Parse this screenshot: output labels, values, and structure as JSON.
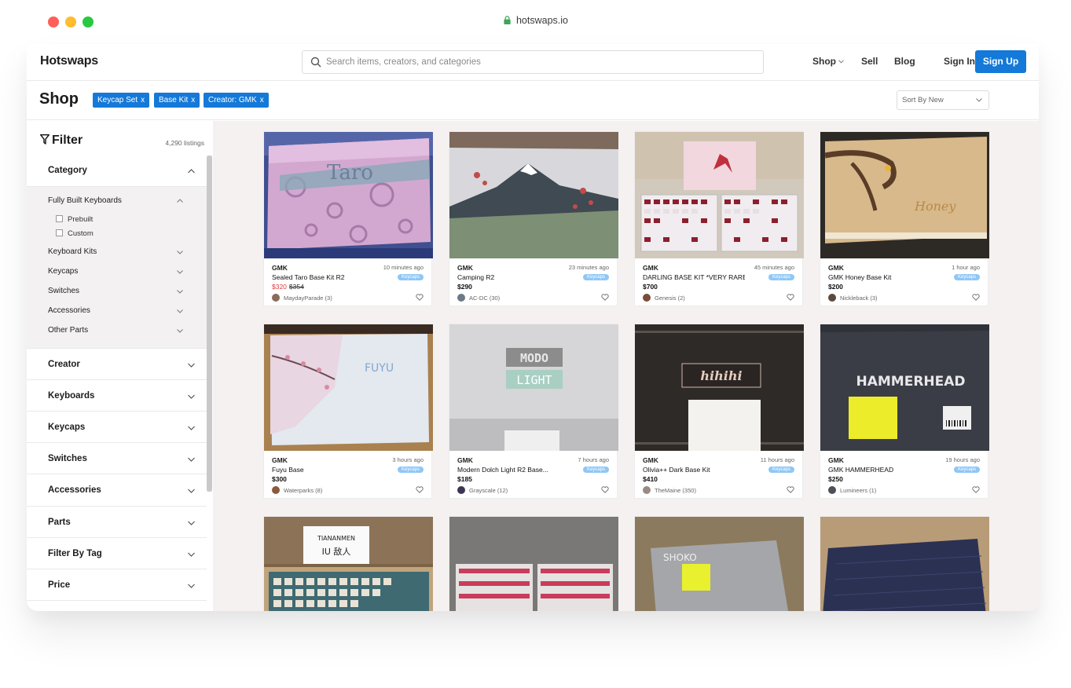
{
  "browser": {
    "url": "hotswaps.io"
  },
  "header": {
    "logo": "Hotswaps",
    "search_placeholder": "Search items, creators, and categories",
    "nav": {
      "shop": "Shop",
      "sell": "Sell",
      "blog": "Blog",
      "sign_in": "Sign In",
      "sign_up": "Sign Up"
    }
  },
  "shopbar": {
    "title": "Shop",
    "chips": [
      "Keycap Set",
      "Base Kit",
      "Creator: GMK"
    ],
    "chip_close": "x",
    "sort": "Sort By New"
  },
  "sidebar": {
    "title": "Filter",
    "listings": "4,290 listings",
    "category": {
      "title": "Category",
      "items": [
        "Fully Built Keyboards",
        "Keyboard Kits",
        "Keycaps",
        "Switches",
        "Accessories",
        "Other Parts"
      ],
      "checkboxes": [
        "Prebuilt",
        "Custom"
      ]
    },
    "sections": [
      "Creator",
      "Keyboards",
      "Keycaps",
      "Switches",
      "Accessories",
      "Parts",
      "Filter By Tag",
      "Price"
    ]
  },
  "listings": [
    {
      "brand": "GMK",
      "time": "10 minutes ago",
      "name": "Sealed Taro Base Kit R2",
      "tag": "Keycaps",
      "price": "$320",
      "old_price": "$354",
      "seller": "MaydayParade (3)",
      "image_icon": "taro-box-image"
    },
    {
      "brand": "GMK",
      "time": "23 minutes ago",
      "name": "Camping R2",
      "tag": "Keycaps",
      "price": "$290",
      "seller": "AC-DC (30)",
      "image_icon": "mountain-box-image"
    },
    {
      "brand": "GMK",
      "time": "45 minutes ago",
      "name": "DARLING BASE KIT *VERY RARE*",
      "tag": "Keycaps",
      "price": "$700",
      "seller": "Genesis (2)",
      "image_icon": "darling-keycaps-image"
    },
    {
      "brand": "GMK",
      "time": "1 hour ago",
      "name": "GMK Honey Base Kit",
      "tag": "Keycaps",
      "price": "$200",
      "seller": "Nickleback (3)",
      "image_icon": "honey-box-image"
    },
    {
      "brand": "GMK",
      "time": "3 hours ago",
      "name": "Fuyu Base",
      "tag": "Keycaps",
      "price": "$300",
      "seller": "Waterparks (8)",
      "image_icon": "fuyu-box-image"
    },
    {
      "brand": "GMK",
      "time": "7 hours ago",
      "name": "Modern Dolch Light R2 Base...",
      "tag": "Keycaps",
      "price": "$185",
      "seller": "Grayscale (12)",
      "image_icon": "modo-light-box-image"
    },
    {
      "brand": "GMK",
      "time": "11 hours ago",
      "name": "Olivia++ Dark Base Kit",
      "tag": "Keycaps",
      "price": "$410",
      "seller": "TheMaine (350)",
      "image_icon": "olivia-box-image"
    },
    {
      "brand": "GMK",
      "time": "19 hours ago",
      "name": "GMK HAMMERHEAD",
      "tag": "Keycaps",
      "price": "$250",
      "seller": "Lumineers (1)",
      "image_icon": "hammerhead-box-image"
    },
    {
      "image_icon": "tiananmen-keycaps-image",
      "image_text": [
        "TIANANMEN",
        "IU 敌人"
      ]
    },
    {
      "image_icon": "red-keycaps-image"
    },
    {
      "image_icon": "shoko-box-image",
      "image_text": [
        "SHOKO"
      ]
    },
    {
      "image_icon": "navy-keycaps-image"
    }
  ],
  "image_text": {
    "taro": "Taro",
    "fuyu": "FUYU",
    "modo": "MODO",
    "light": "LIGHT",
    "hihihi": "hihihi",
    "hammerhead": "HAMMERHEAD",
    "honey": "Honey"
  },
  "colors": {
    "accent": "#1479d8",
    "tag": "#8ec7f7",
    "sale": "#e0393e",
    "grid_bg": "#f5f1f1"
  }
}
